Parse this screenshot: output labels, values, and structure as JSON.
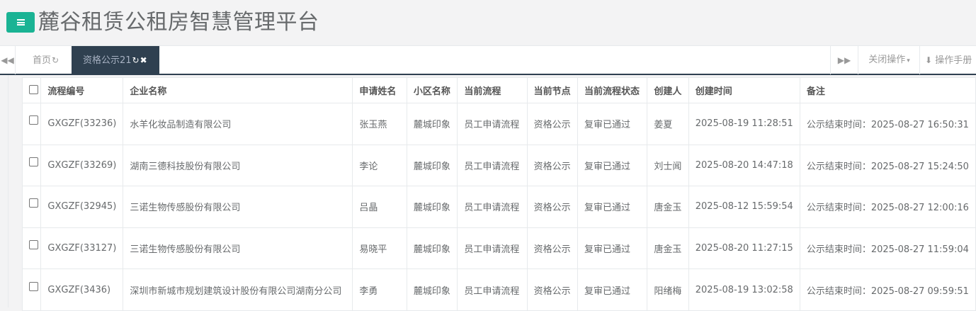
{
  "header": {
    "title": "麓谷租赁公租房智慧管理平台"
  },
  "tabs": {
    "home_label": "首页",
    "active_label": "资格公示21",
    "close_ops_label": "关闭操作",
    "manual_label": "操作手册"
  },
  "icons": {
    "menu": "bars-icon",
    "prev": "backward-icon",
    "next": "forward-icon",
    "refresh": "refresh-icon",
    "close": "close-icon",
    "download": "download-icon"
  },
  "colors": {
    "accent": "#1ab394",
    "dark": "#2f4050"
  },
  "table": {
    "columns": [
      "流程编号",
      "企业名称",
      "申请姓名",
      "小区名称",
      "当前流程",
      "当前节点",
      "当前流程状态",
      "创建人",
      "创建时间",
      "备注"
    ],
    "rows": [
      [
        "GXGZF(33236)",
        "水羊化妆品制造有限公司",
        "张玉燕",
        "麓城印象",
        "员工申请流程",
        "资格公示",
        "复审已通过",
        "姜夏",
        "2025-08-19 11:28:51",
        "公示结束时间：2025-08-27 16:50:31"
      ],
      [
        "GXGZF(33269)",
        "湖南三德科技股份有限公司",
        "李论",
        "麓城印象",
        "员工申请流程",
        "资格公示",
        "复审已通过",
        "刘士闻",
        "2025-08-20 14:47:18",
        "公示结束时间：2025-08-27 15:24:50"
      ],
      [
        "GXGZF(32945)",
        "三诺生物传感股份有限公司",
        "吕晶",
        "麓城印象",
        "员工申请流程",
        "资格公示",
        "复审已通过",
        "唐金玉",
        "2025-08-12 15:59:54",
        "公示结束时间：2025-08-27 12:00:16"
      ],
      [
        "GXGZF(33127)",
        "三诺生物传感股份有限公司",
        "易晓平",
        "麓城印象",
        "员工申请流程",
        "资格公示",
        "复审已通过",
        "唐金玉",
        "2025-08-20 11:27:15",
        "公示结束时间：2025-08-27 11:59:04"
      ],
      [
        "GXGZF(3436)",
        "深圳市新城市规划建筑设计股份有限公司湖南分公司",
        "李勇",
        "麓城印象",
        "员工申请流程",
        "资格公示",
        "复审已通过",
        "阳绪梅",
        "2025-08-19 13:02:58",
        "公示结束时间：2025-08-27 09:59:51"
      ]
    ]
  }
}
